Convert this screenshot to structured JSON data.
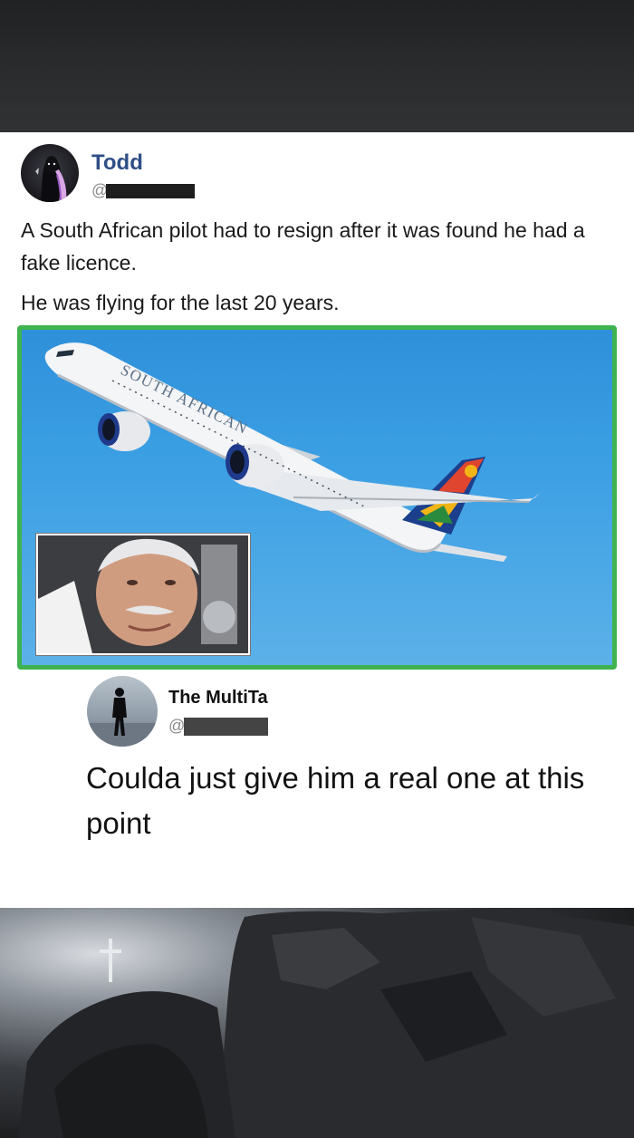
{
  "post": {
    "author_name": "Todd",
    "author_handle": "@",
    "text_line1": "A South African pilot had to resign after it was found he had a fake licence.",
    "text_line2": "He was flying for the last 20 years.",
    "media_airline_text": "SOUTH AFRICAN",
    "media_border_color": "#3fb34f"
  },
  "reply": {
    "author_name": "The MultiTa",
    "author_handle": "@",
    "text": "Coulda just give him a real one at this point"
  }
}
